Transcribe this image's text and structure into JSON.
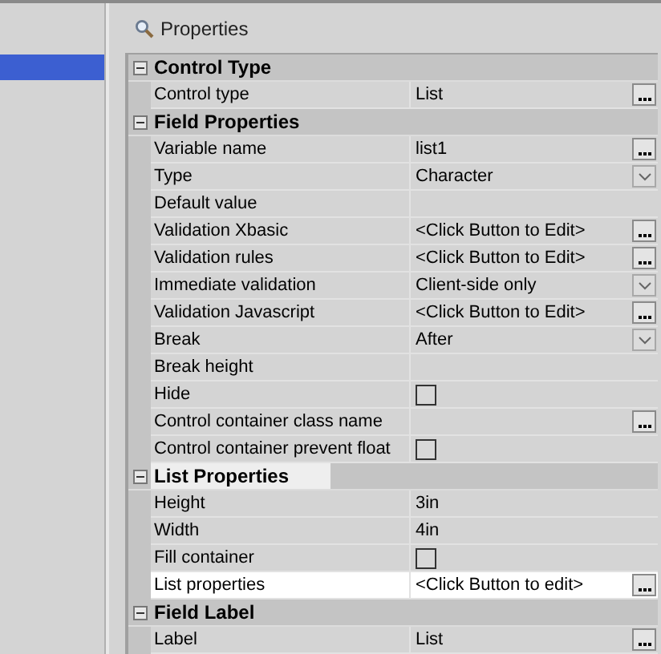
{
  "left_list": {
    "items": [
      {
        "selected": true
      }
    ]
  },
  "header": {
    "title": "Properties"
  },
  "categories": [
    {
      "title": "Control Type",
      "expanded": true,
      "highlighted": false,
      "rows": [
        {
          "name": "Control type",
          "value": "List",
          "kind": "ellipsis",
          "selected": false
        }
      ]
    },
    {
      "title": "Field Properties",
      "expanded": true,
      "highlighted": false,
      "rows": [
        {
          "name": "Variable name",
          "value": "list1",
          "kind": "ellipsis",
          "selected": false
        },
        {
          "name": "Type",
          "value": "Character",
          "kind": "dropdown",
          "selected": false
        },
        {
          "name": "Default value",
          "kind": "text",
          "selected": false
        },
        {
          "name": "Validation Xbasic",
          "value": "<Click Button to Edit>",
          "kind": "ellipsis",
          "selected": false
        },
        {
          "name": "Validation rules",
          "value": "<Click Button to Edit>",
          "kind": "ellipsis",
          "selected": false
        },
        {
          "name": "Immediate validation",
          "value": "Client-side only",
          "kind": "dropdown",
          "selected": false
        },
        {
          "name": "Validation Javascript",
          "value": "<Click Button to Edit>",
          "kind": "ellipsis",
          "selected": false
        },
        {
          "name": "Break",
          "value": "After",
          "kind": "dropdown",
          "selected": false
        },
        {
          "name": "Break height",
          "kind": "text",
          "selected": false
        },
        {
          "name": "Hide",
          "kind": "checkbox",
          "checked": false,
          "selected": false
        },
        {
          "name": "Control container class name",
          "kind": "ellipsis",
          "selected": false
        },
        {
          "name": "Control container prevent float",
          "kind": "checkbox",
          "checked": false,
          "selected": false
        }
      ]
    },
    {
      "title": "List Properties",
      "expanded": true,
      "highlighted": true,
      "rows": [
        {
          "name": "Height",
          "value": "3in",
          "kind": "text",
          "selected": false
        },
        {
          "name": "Width",
          "value": "4in",
          "kind": "text",
          "selected": false
        },
        {
          "name": "Fill container",
          "kind": "checkbox",
          "checked": false,
          "selected": false
        },
        {
          "name": "List properties",
          "value": "<Click Button to edit>",
          "kind": "ellipsis",
          "selected": true
        }
      ]
    },
    {
      "title": "Field Label",
      "expanded": true,
      "highlighted": false,
      "rows": [
        {
          "name": "Label",
          "value": "List",
          "kind": "ellipsis",
          "selected": false
        }
      ]
    }
  ]
}
